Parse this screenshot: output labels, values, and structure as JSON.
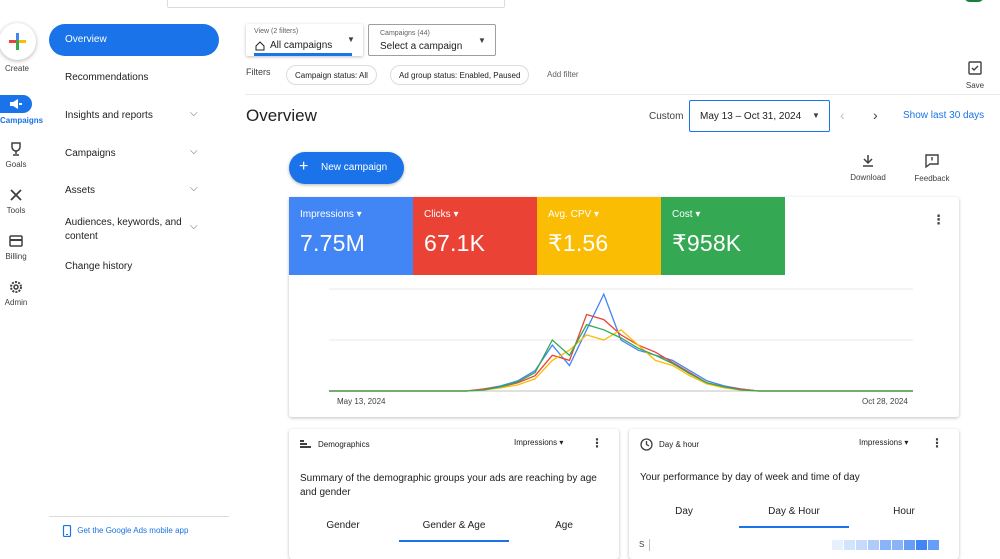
{
  "rail": {
    "create": "Create",
    "campaigns": "Campaigns",
    "goals": "Goals",
    "tools": "Tools",
    "billing": "Billing",
    "admin": "Admin"
  },
  "nav": {
    "overview": "Overview",
    "recommendations": "Recommendations",
    "insights": "Insights and reports",
    "campaigns": "Campaigns",
    "assets": "Assets",
    "audiences_line1": "Audiences, keywords, and",
    "audiences_line2": "content",
    "change_history": "Change history",
    "mobile_app": "Get the Google Ads mobile app"
  },
  "filters_bar": {
    "view_small": "View (2 filters)",
    "view_value": "All campaigns",
    "campaigns_small": "Campaigns (44)",
    "campaigns_value": "Select a campaign",
    "filters_label": "Filters",
    "chip1": "Campaign status: All",
    "chip2": "Ad group status: Enabled, Paused",
    "add_filter": "Add filter",
    "save": "Save"
  },
  "header": {
    "title": "Overview",
    "custom": "Custom",
    "date_range": "May 13 – Oct 31, 2024",
    "show_last": "Show last 30 days"
  },
  "actions": {
    "new_campaign": "New campaign",
    "download": "Download",
    "feedback": "Feedback"
  },
  "metrics": [
    {
      "label": "Impressions",
      "value": "7.75M",
      "color": "#4285f4"
    },
    {
      "label": "Clicks",
      "value": "67.1K",
      "color": "#ea4335"
    },
    {
      "label": "Avg. CPV",
      "value": "₹1.56",
      "color": "#fbbc04"
    },
    {
      "label": "Cost",
      "value": "₹958K",
      "color": "#34a853"
    }
  ],
  "chart_data": {
    "type": "line",
    "x_start_label": "May 13, 2024",
    "x_end_label": "Oct 28, 2024",
    "series": [
      {
        "color": "#4285f4",
        "values": [
          0,
          0,
          0,
          0,
          0,
          0,
          0,
          0,
          0,
          0.02,
          0.05,
          0.1,
          0.2,
          0.45,
          0.25,
          0.6,
          0.95,
          0.5,
          0.4,
          0.35,
          0.3,
          0.2,
          0.1,
          0.05,
          0.02,
          0,
          0,
          0,
          0,
          0,
          0,
          0,
          0,
          0,
          0
        ]
      },
      {
        "color": "#ea4335",
        "values": [
          0,
          0,
          0,
          0,
          0,
          0,
          0,
          0,
          0,
          0.02,
          0.04,
          0.08,
          0.15,
          0.35,
          0.3,
          0.75,
          0.7,
          0.55,
          0.45,
          0.38,
          0.28,
          0.18,
          0.08,
          0.04,
          0.02,
          0,
          0,
          0,
          0,
          0,
          0,
          0,
          0,
          0,
          0
        ]
      },
      {
        "color": "#fbbc04",
        "values": [
          0,
          0,
          0,
          0,
          0,
          0,
          0,
          0,
          0,
          0.01,
          0.03,
          0.06,
          0.12,
          0.3,
          0.4,
          0.55,
          0.5,
          0.6,
          0.45,
          0.3,
          0.25,
          0.15,
          0.07,
          0.03,
          0.01,
          0,
          0,
          0,
          0,
          0,
          0,
          0,
          0,
          0,
          0
        ]
      },
      {
        "color": "#34a853",
        "values": [
          0,
          0,
          0,
          0,
          0,
          0,
          0,
          0,
          0,
          0.01,
          0.04,
          0.09,
          0.18,
          0.5,
          0.35,
          0.65,
          0.6,
          0.52,
          0.42,
          0.35,
          0.27,
          0.17,
          0.08,
          0.04,
          0.01,
          0,
          0,
          0,
          0,
          0,
          0,
          0,
          0,
          0,
          0
        ]
      }
    ]
  },
  "demographics": {
    "title": "Demographics",
    "metric": "Impressions",
    "summary": "Summary of the demographic groups your ads are reaching by age and gender",
    "tabs": [
      "Gender",
      "Gender & Age",
      "Age"
    ]
  },
  "dayhour": {
    "title": "Day & hour",
    "metric": "Impressions",
    "summary": "Your performance by day of week and time of day",
    "tabs": [
      "Day",
      "Day & Hour",
      "Hour"
    ],
    "row_label": "S"
  }
}
